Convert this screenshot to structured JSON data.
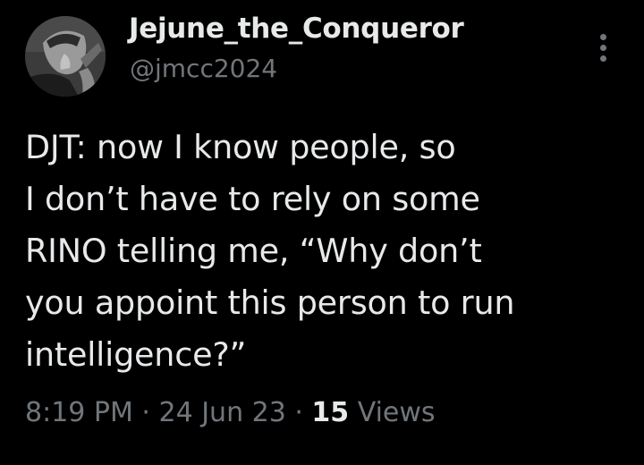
{
  "author": {
    "display_name": "Jejune_the_Conqueror",
    "handle": "@jmcc2024",
    "avatar_icon": "profile-photo"
  },
  "more_icon": "more-vertical-icon",
  "tweet": {
    "lines": [
      "DJT: now I know people, so",
      "I don’t have to rely on some",
      "RINO telling me, “Why don’t",
      "you appoint this person to run",
      "intelligence?”"
    ]
  },
  "meta": {
    "time": "8:19 PM",
    "separator": " · ",
    "date": "24 Jun 23",
    "view_count": "15",
    "views_label": "Views"
  },
  "colors": {
    "background": "#000000",
    "text": "#e7e9ea",
    "secondary": "#71767b"
  }
}
